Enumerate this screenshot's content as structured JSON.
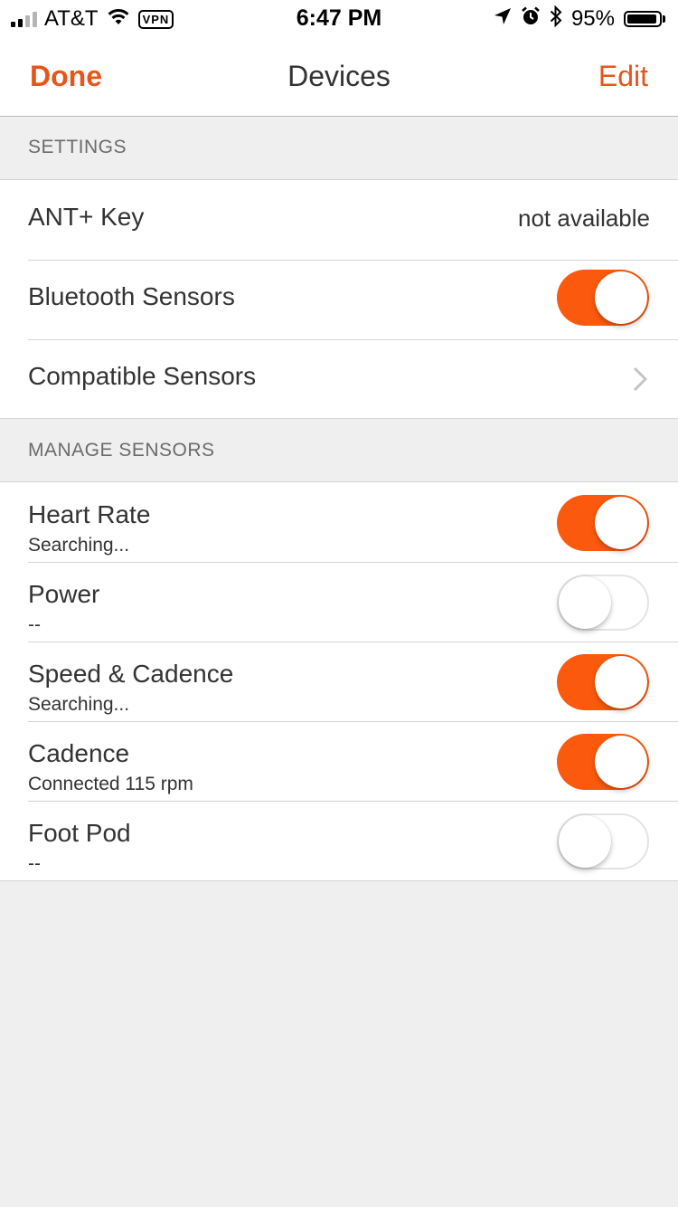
{
  "status_bar": {
    "carrier": "AT&T",
    "vpn_label": "VPN",
    "time": "6:47 PM",
    "battery_percent": "95%",
    "battery_level": 0.95,
    "signal_bars": 2,
    "icons": [
      "signal-icon",
      "wifi-icon",
      "vpn-icon",
      "location-arrow-icon",
      "alarm-icon",
      "bluetooth-icon",
      "battery-icon"
    ]
  },
  "nav": {
    "done_label": "Done",
    "title": "Devices",
    "edit_label": "Edit"
  },
  "colors": {
    "accent": "#e8551a",
    "toggle_on": "#fb5a0e",
    "background": "#efefef"
  },
  "settings": {
    "header": "SETTINGS",
    "ant_key": {
      "label": "ANT+ Key",
      "value": "not available"
    },
    "bluetooth_sensors": {
      "label": "Bluetooth Sensors",
      "enabled": true
    },
    "compatible_sensors": {
      "label": "Compatible Sensors",
      "icon": "chevron-right-icon"
    }
  },
  "manage": {
    "header": "MANAGE SENSORS",
    "sensors": [
      {
        "title": "Heart Rate",
        "status": "Searching...",
        "enabled": true
      },
      {
        "title": "Power",
        "status": "--",
        "enabled": false
      },
      {
        "title": "Speed & Cadence",
        "status": "Searching...",
        "enabled": true
      },
      {
        "title": "Cadence",
        "status": "Connected 115 rpm",
        "enabled": true
      },
      {
        "title": "Foot Pod",
        "status": "--",
        "enabled": false
      }
    ]
  }
}
